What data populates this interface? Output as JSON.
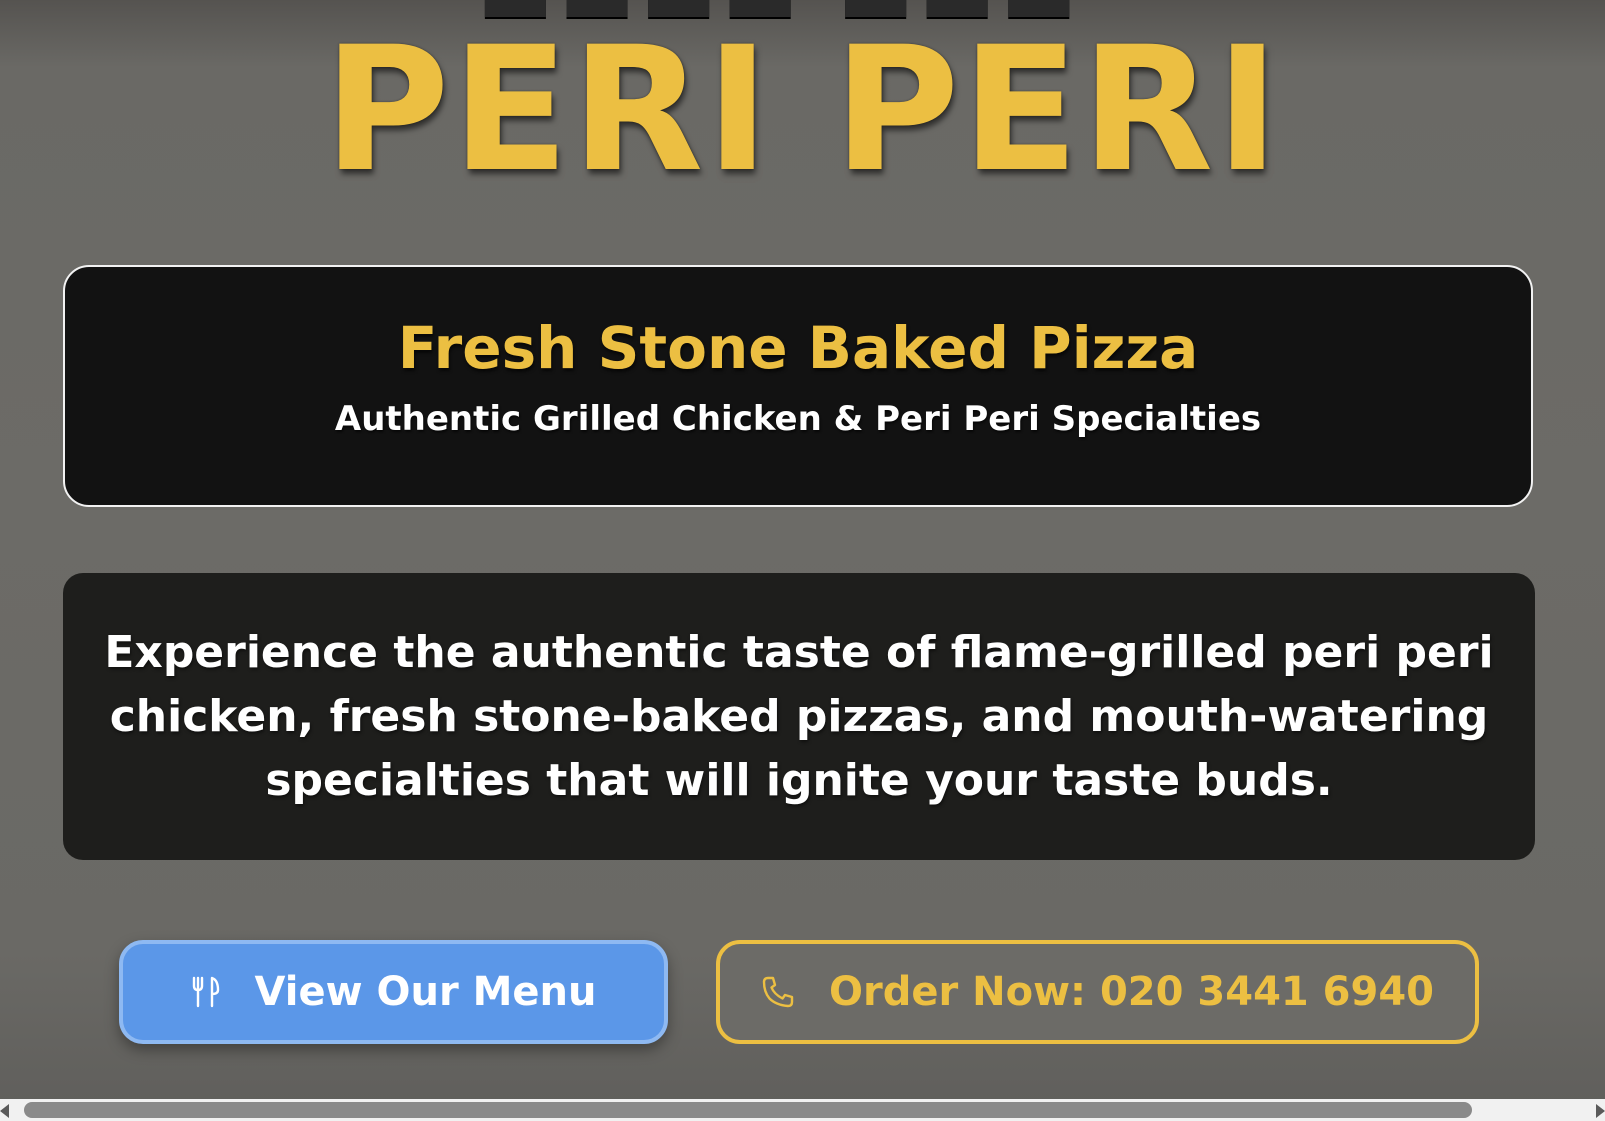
{
  "hero": {
    "title": "PERI PERI"
  },
  "tagline": {
    "heading": "Fresh Stone Baked Pizza",
    "subheading": "Authentic Grilled Chicken & Peri Peri Specialties"
  },
  "intro": {
    "text": "Experience the authentic taste of flame-grilled peri peri chicken, fresh stone-baked pizzas, and mouth-watering specialties that will ignite your taste buds."
  },
  "buttons": {
    "menu": {
      "label": "View Our Menu",
      "icon": "utensils-icon"
    },
    "order": {
      "label": "Order Now: 020 3441 6940",
      "icon": "phone-icon"
    }
  },
  "colors": {
    "accent_gold": "#ecbf42",
    "menu_button_blue": "#5b97e8",
    "card_dark": "#121212",
    "page_background": "#6c6b67"
  }
}
